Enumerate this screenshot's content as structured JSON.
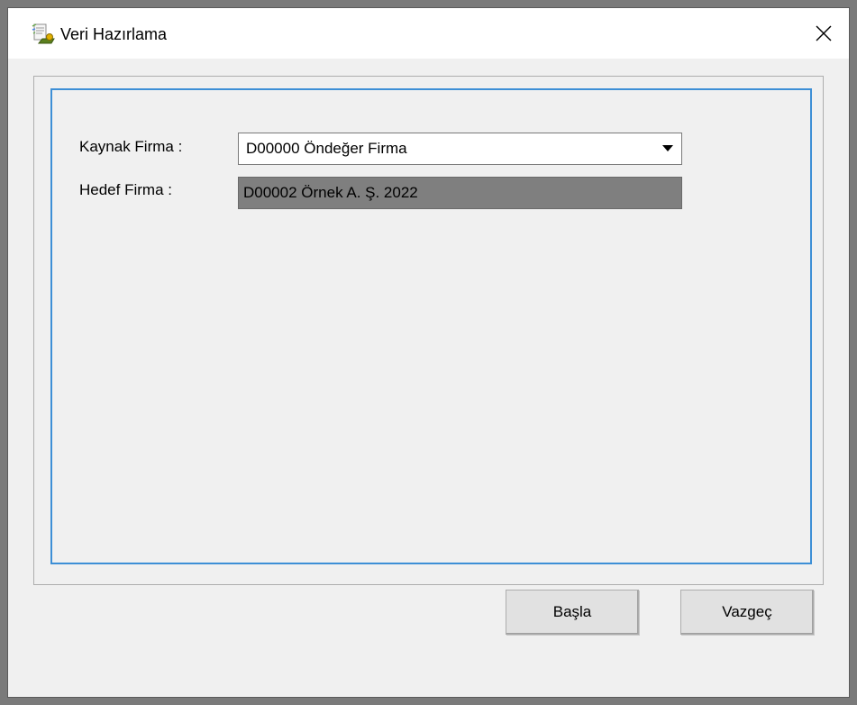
{
  "window": {
    "title": "Veri Hazırlama",
    "icon": "data-prep-icon",
    "close_icon": "close-icon"
  },
  "form": {
    "source_label": "Kaynak Firma :",
    "source_value": "D00000 Öndeğer Firma",
    "target_label": "Hedef Firma :",
    "target_value": "D00002 Örnek A. Ş. 2022"
  },
  "buttons": {
    "start_label": "Başla",
    "cancel_label": "Vazgeç"
  },
  "colors": {
    "panel_border": "#3d8fd6",
    "readonly_bg": "#7f7f7f",
    "window_bg": "#f0f0f0"
  }
}
